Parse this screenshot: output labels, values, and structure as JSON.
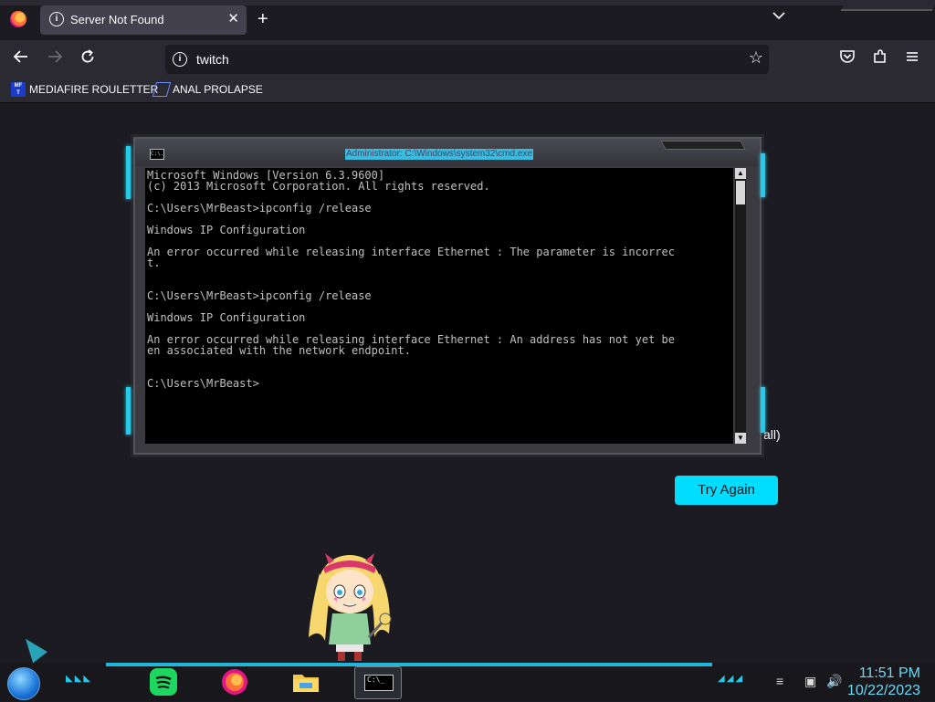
{
  "browser": {
    "tab": {
      "title": "Server Not Found",
      "close": "✕"
    },
    "new_tab": "+",
    "tab_list": "⌄",
    "url": "twitch",
    "bookmarks": [
      {
        "label": "MEDIAFIRE ROULETTER",
        "icon": "mediafire-icon",
        "icon_text": "MF\nT"
      },
      {
        "label": "ANAL PROLAPSE",
        "icon": "bookmark-sigma-icon"
      }
    ]
  },
  "page": {
    "try_again": "Try Again",
    "partial_text": "all)"
  },
  "cmd": {
    "title": "Administrator: C:\\Windows\\system32\\cmd.exe",
    "icon_text": "C:\\.",
    "lines": [
      "Microsoft Windows [Version 6.3.9600]",
      "(c) 2013 Microsoft Corporation. All rights reserved.",
      "",
      "C:\\Users\\MrBeast>ipconfig /release",
      "",
      "Windows IP Configuration",
      "",
      "An error occurred while releasing interface Ethernet : The parameter is incorrec",
      "t.",
      "",
      "",
      "C:\\Users\\MrBeast>ipconfig /release",
      "",
      "Windows IP Configuration",
      "",
      "An error occurred while releasing interface Ethernet : An address has not yet be",
      "en associated with the network endpoint.",
      "",
      "",
      "C:\\Users\\MrBeast>"
    ]
  },
  "taskbar": {
    "apps": [
      "spotify-icon",
      "firefox-icon",
      "file-explorer-icon",
      "cmd-icon"
    ],
    "cmd_app_text": "C:\\_",
    "clock_time": "11:51 PM",
    "clock_date": "10/22/2023",
    "accent_color": "#27c9e8"
  }
}
